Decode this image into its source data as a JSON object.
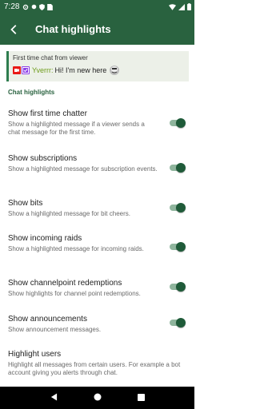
{
  "status_bar": {
    "time": "7:28"
  },
  "app_bar": {
    "title": "Chat highlights"
  },
  "preview": {
    "title": "First time chat from viewer",
    "username": "Yverrr:",
    "message": "Hi! I'm new here"
  },
  "section_header": "Chat highlights",
  "settings": [
    {
      "title": "Show first time chatter",
      "summary": "Show a highlighted message if a viewer sends a chat message for the first time.",
      "enabled": true
    },
    {
      "title": "Show subscriptions",
      "summary": "Show a highlighted message for subscription events.",
      "enabled": true
    },
    {
      "title": "Show bits",
      "summary": "Show a highlighted message for bit cheers.",
      "enabled": true
    },
    {
      "title": "Show incoming raids",
      "summary": "Show a highlighted message for incoming raids.",
      "enabled": true
    },
    {
      "title": "Show channelpoint redemptions",
      "summary": "Show highlights for channel point redemptions.",
      "enabled": true
    },
    {
      "title": "Show announcements",
      "summary": "Show announcement messages.",
      "enabled": true
    },
    {
      "title": "Highlight users",
      "summary": "Highlight all messages from certain users. For example a bot account giving you alerts through chat."
    }
  ],
  "colors": {
    "primary": "#29623f",
    "toggle_on": "#1f5b39",
    "username": "#6e9c1a"
  }
}
